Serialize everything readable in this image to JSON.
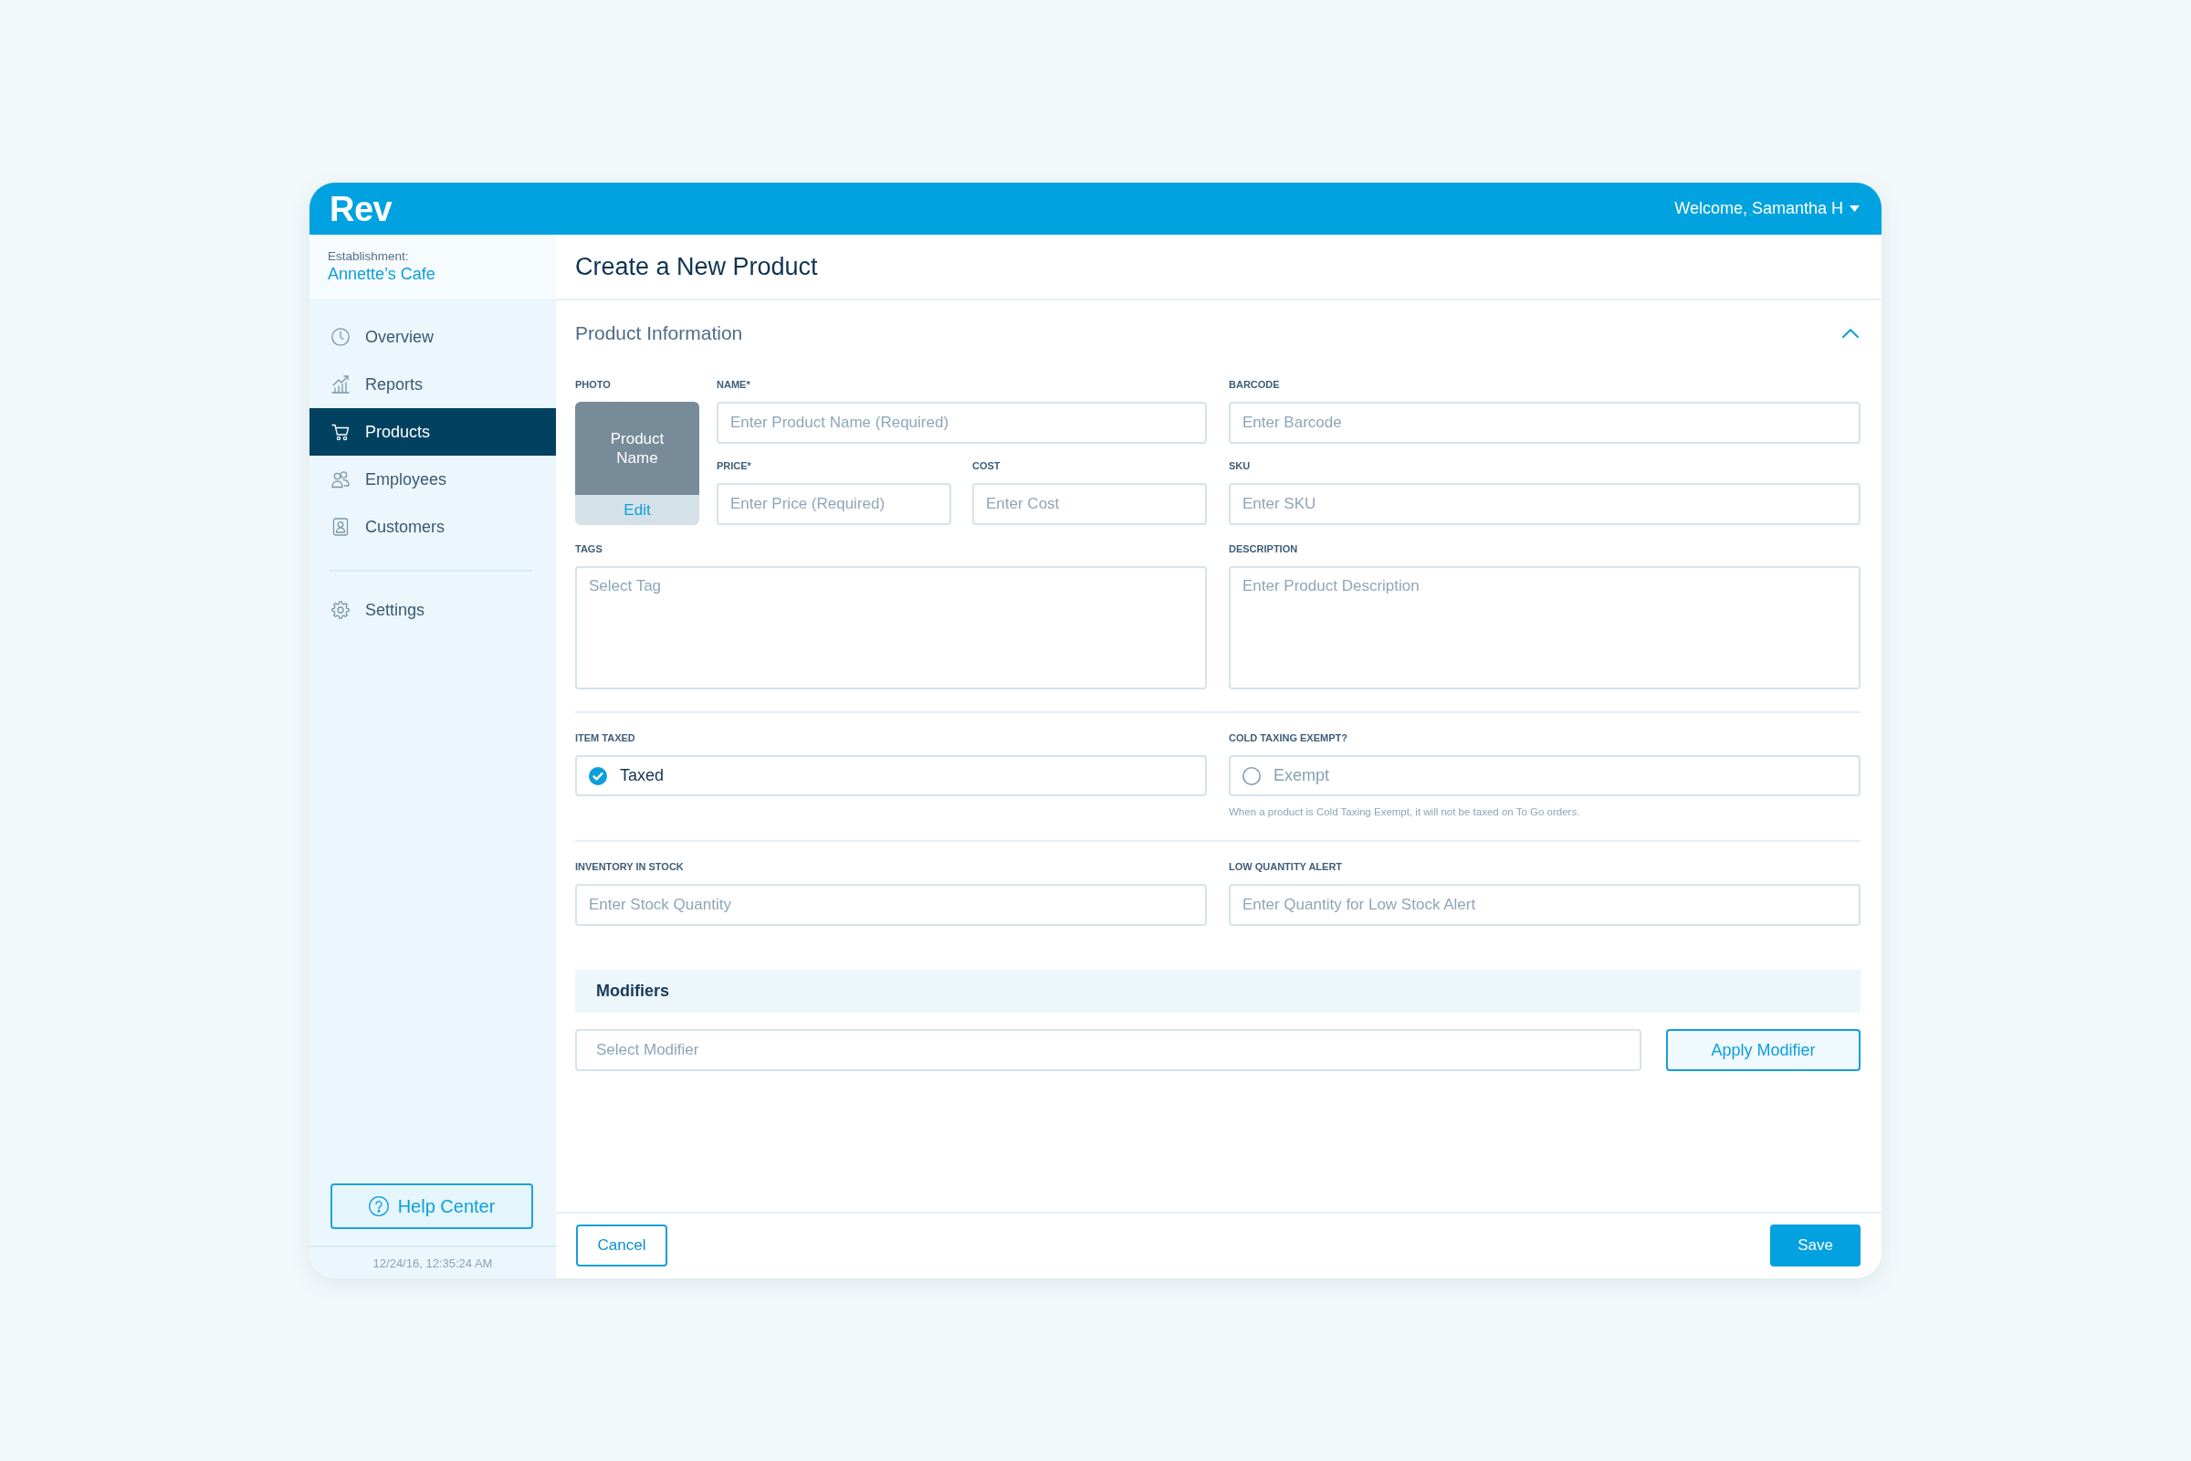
{
  "header": {
    "logo": "Rev",
    "user_menu": "Welcome, Samantha H"
  },
  "sidebar": {
    "establishment_label": "Establishment:",
    "establishment_name": "Annette’s Cafe",
    "nav_groups": [
      {
        "items": [
          {
            "label": "Overview",
            "selected": false
          },
          {
            "label": "Reports",
            "selected": false
          },
          {
            "label": "Products",
            "selected": true
          },
          {
            "label": "Employees",
            "selected": false
          },
          {
            "label": "Customers",
            "selected": false
          }
        ]
      },
      {
        "items": [
          {
            "label": "Settings",
            "selected": false
          }
        ]
      }
    ],
    "help_button": "Help Center",
    "timestamp": "12/24/16, 12:35:24 AM"
  },
  "page_title": "Create a New Product",
  "product_information": {
    "title": "Product Information",
    "expanded": true,
    "photo": {
      "label": "PHOTO",
      "caption": "Product Name",
      "edit_button": "Edit"
    },
    "name": {
      "label": "NAME*",
      "placeholder": "Enter Product Name (Required)"
    },
    "price": {
      "label": "PRICE*",
      "placeholder": "Enter Price (Required)"
    },
    "cost": {
      "label": "COST",
      "placeholder": "Enter Cost"
    },
    "barcode": {
      "label": "BARCODE",
      "placeholder": "Enter Barcode"
    },
    "sku": {
      "label": "SKU",
      "placeholder": "Enter SKU"
    },
    "tags": {
      "label": "TAGS",
      "placeholder": "Select Tag"
    },
    "description": {
      "label": "DESCRIPTION",
      "placeholder": "Enter Product Description"
    },
    "item_taxed": {
      "label": "ITEM TAXED",
      "option": "Taxed",
      "checked": true
    },
    "cold_taxing_exempt": {
      "label": "COLD TAXING EXEMPT?",
      "option": "Exempt",
      "checked": false,
      "note": "When a product is Cold Taxing Exempt, it will not be taxed on To Go orders."
    },
    "inventory_in_stock": {
      "label": "INVENTORY IN STOCK",
      "placeholder": "Enter Stock Quantity"
    },
    "low_quantity_alert": {
      "label": "LOW QUANTITY ALERT",
      "placeholder": "Enter Quantity for Low Stock Alert"
    }
  },
  "modifiers": {
    "title": "Modifiers",
    "placeholder": "Select Modifier",
    "apply_button": "Apply Modifier"
  },
  "footer": {
    "cancel_button": "Cancel",
    "save_button": "Save"
  }
}
